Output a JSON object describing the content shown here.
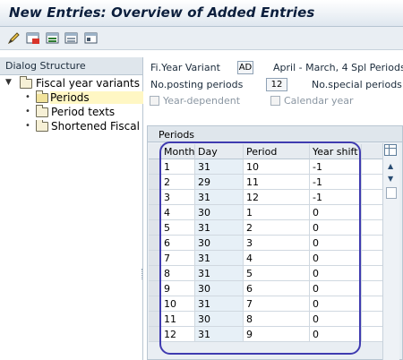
{
  "title": "New Entries: Overview of Added Entries",
  "toolbar": {
    "icons": [
      "edit-pencil-icon",
      "delete-row-icon",
      "select-all-icon",
      "deselect-all-icon",
      "choose-icon"
    ]
  },
  "dialog_structure": {
    "header": "Dialog Structure",
    "root": "Fiscal year variants",
    "items": [
      "Periods",
      "Period texts",
      "Shortened Fiscal Y"
    ]
  },
  "header_fields": {
    "variant_label": "Fi.Year Variant",
    "variant_value": "AD",
    "variant_desc": "April - March, 4 Spl Periods",
    "posting_label": "No.posting periods",
    "posting_value": "12",
    "special_label": "No.special periods",
    "year_dependent": "Year-dependent",
    "calendar_year": "Calendar year"
  },
  "periods": {
    "section_title": "Periods",
    "columns": [
      "Month",
      "Day",
      "Period",
      "Year shift"
    ],
    "rows": [
      [
        "1",
        "31",
        "10",
        "-1"
      ],
      [
        "2",
        "29",
        "11",
        "-1"
      ],
      [
        "3",
        "31",
        "12",
        "-1"
      ],
      [
        "4",
        "30",
        "1",
        "0"
      ],
      [
        "5",
        "31",
        "2",
        "0"
      ],
      [
        "6",
        "30",
        "3",
        "0"
      ],
      [
        "7",
        "31",
        "4",
        "0"
      ],
      [
        "8",
        "31",
        "5",
        "0"
      ],
      [
        "9",
        "30",
        "6",
        "0"
      ],
      [
        "10",
        "31",
        "7",
        "0"
      ],
      [
        "11",
        "30",
        "8",
        "0"
      ],
      [
        "12",
        "31",
        "9",
        "0"
      ]
    ]
  },
  "colors": {
    "highlight": "#3f3bb0",
    "selected_tree_item": "#fff7c4"
  }
}
